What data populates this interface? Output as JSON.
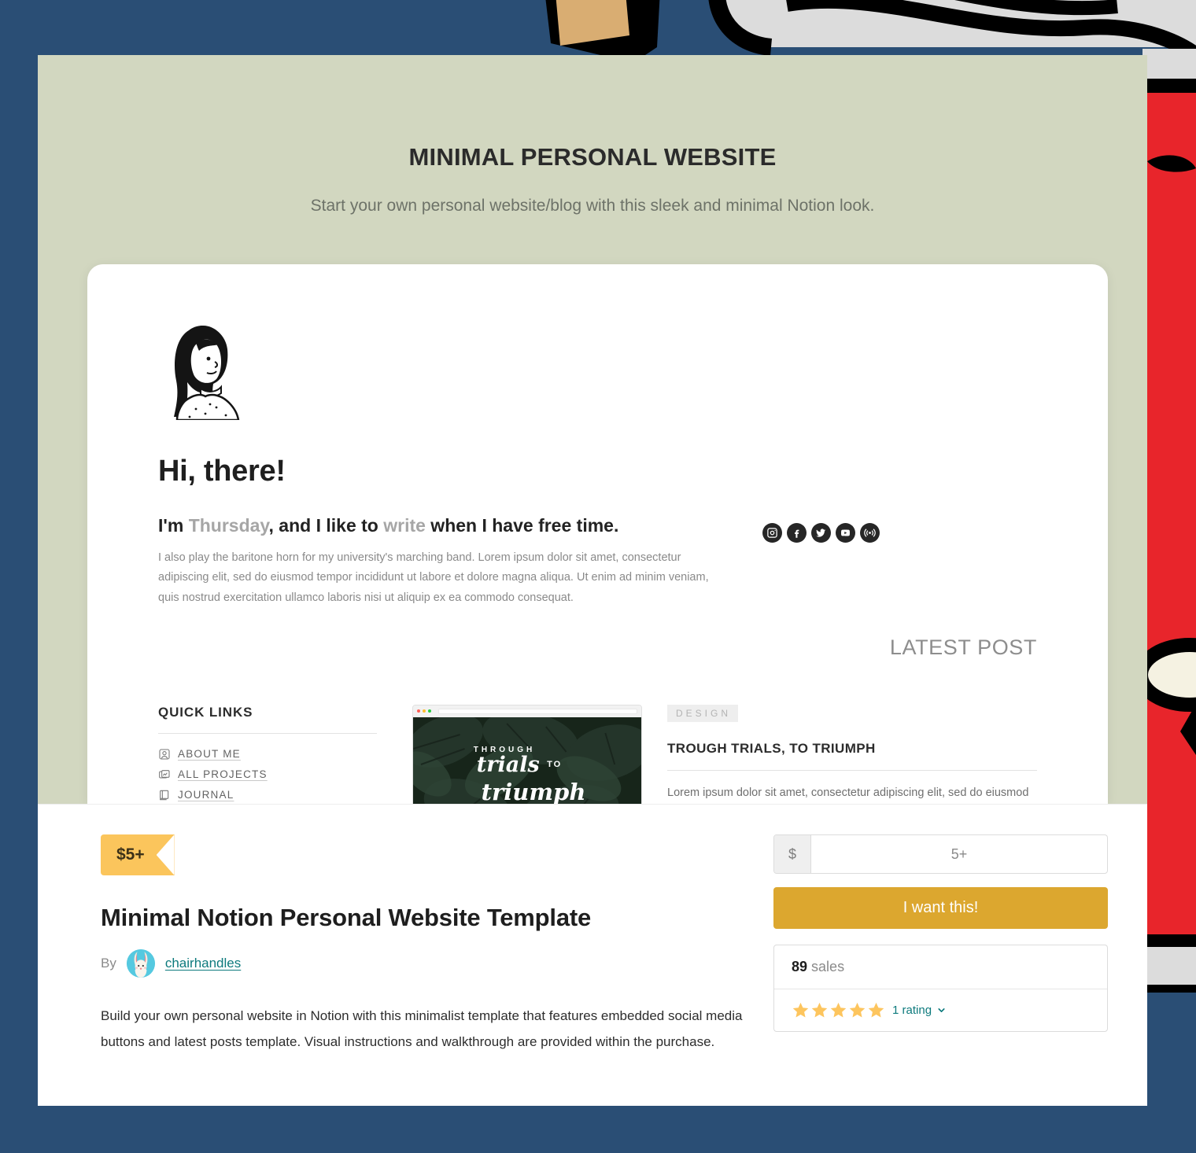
{
  "background": {
    "base_color": "#2a4e75",
    "art_colors": [
      "#e8252b",
      "#dcdcdc",
      "#000000",
      "#d9ad72",
      "#f5f2e2"
    ]
  },
  "cover": {
    "bg_color": "#d2d7c0",
    "title": "MINIMAL PERSONAL WEBSITE",
    "subtitle": "Start your own personal website/blog with this sleek and minimal Notion look."
  },
  "preview": {
    "avatar_icon": "illustrated-woman-portrait-icon",
    "greeting": "Hi, there!",
    "tagline": {
      "part1": "I'm ",
      "name": "Thursday",
      "part2": ", and I like to ",
      "verb": "write",
      "part3": " when I have free time."
    },
    "body": "I also play the baritone horn for my university's marching band. Lorem ipsum dolor sit amet, consectetur adipiscing elit, sed do eiusmod tempor incididunt ut labore et dolore magna aliqua. Ut enim ad minim veniam, quis nostrud exercitation ullamco laboris nisi ut aliquip ex ea commodo consequat.",
    "socials": [
      {
        "name": "instagram-icon",
        "label": "Instagram"
      },
      {
        "name": "facebook-icon",
        "label": "Facebook"
      },
      {
        "name": "twitter-icon",
        "label": "Twitter"
      },
      {
        "name": "youtube-icon",
        "label": "YouTube"
      },
      {
        "name": "rss-broadcast-icon",
        "label": "RSS"
      }
    ],
    "quick_links": {
      "heading": "QUICK LINKS",
      "items": [
        {
          "label": "ABOUT ME",
          "icon": "person-photo-icon"
        },
        {
          "label": "ALL PROJECTS",
          "icon": "folder-chart-icon"
        },
        {
          "label": "JOURNAL",
          "icon": "book-icon"
        }
      ]
    },
    "thumbnail": {
      "overline": "THROUGH",
      "script1": "trials",
      "script_small": "TO",
      "script2": "triumph",
      "carousel_dots": 3,
      "active_dot": 1,
      "window_dots": [
        "#ff5f56",
        "#ffbd2e",
        "#27c93f"
      ]
    },
    "latest_post": {
      "heading": "LATEST POST",
      "category": "DESIGN",
      "title": "TROUGH TRIALS, TO TRIUMPH",
      "body": "Lorem ipsum dolor sit amet, consectetur adipiscing elit, sed do eiusmod tempor incididunt ut labore et dolore magna aliqua. Ut"
    }
  },
  "product": {
    "price_badge": "$5+",
    "title": "Minimal Notion Personal Website Template",
    "by_label": "By",
    "author": "chairhandles",
    "author_avatar_icon": "rabbit-avatar-icon",
    "description": "Build your own personal website in Notion with this minimalist template that features embedded social media buttons and latest posts template. Visual instructions and walkthrough are provided within the purchase."
  },
  "purchase": {
    "currency_symbol": "$",
    "price_value": "5+",
    "price_placeholder": "5+",
    "cta_label": "I want this!",
    "sales_count": "89",
    "sales_label": "sales",
    "rating_stars": 5,
    "rating_label": "1 rating",
    "chevron_icon": "chevron-down-icon",
    "accent_color": "#dca72f",
    "badge_color": "#fbc55c",
    "link_color": "#0d7a7d"
  }
}
